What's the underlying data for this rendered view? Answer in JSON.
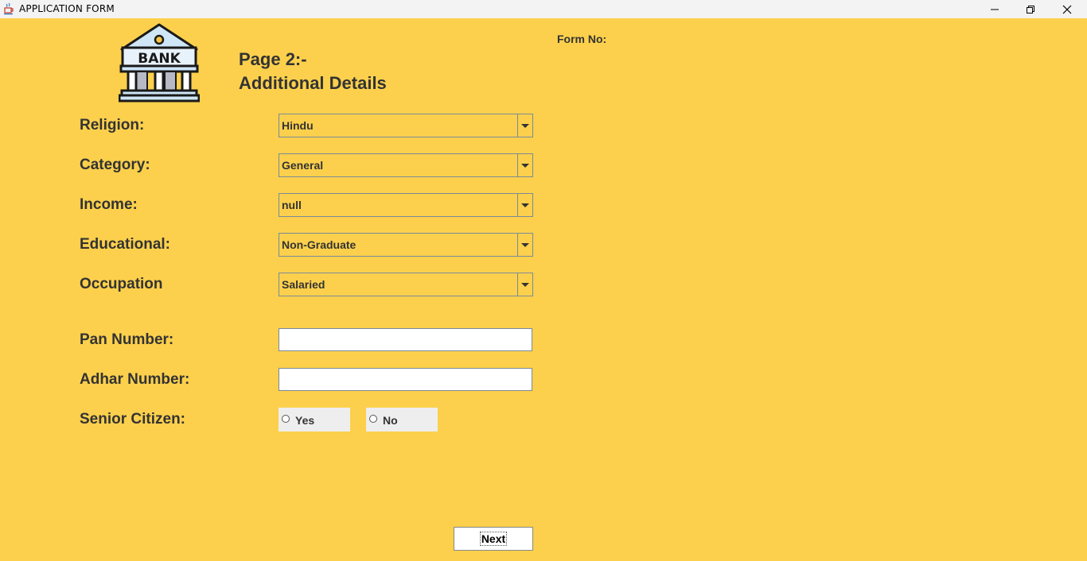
{
  "window": {
    "title": "APPLICATION  FORM",
    "icons": [
      "java-cup-icon",
      "minimize-icon",
      "maximize-icon",
      "close-icon"
    ]
  },
  "header": {
    "logo_text": "BANK",
    "page": "Page 2:-",
    "subtitle": "Additional Details",
    "form_no_label": "Form No:"
  },
  "fields": {
    "religion": {
      "label": "Religion:",
      "value": "Hindu"
    },
    "category": {
      "label": "Category:",
      "value": "General"
    },
    "income": {
      "label": "Income:",
      "value": "null"
    },
    "education": {
      "label": "Educational:",
      "value": "Non-Graduate"
    },
    "occupation": {
      "label": "Occupation",
      "value": "Salaried"
    },
    "pan": {
      "label": "Pan Number:",
      "value": ""
    },
    "aadhar": {
      "label": "Adhar Number:",
      "value": ""
    },
    "senior_citizen": {
      "label": "Senior Citizen:",
      "options": [
        "Yes",
        "No"
      ],
      "selected": null
    }
  },
  "actions": {
    "next_label": "Next"
  },
  "colors": {
    "background": "#fcd04c",
    "text": "#333333",
    "field_border": "#7a8a9a"
  }
}
